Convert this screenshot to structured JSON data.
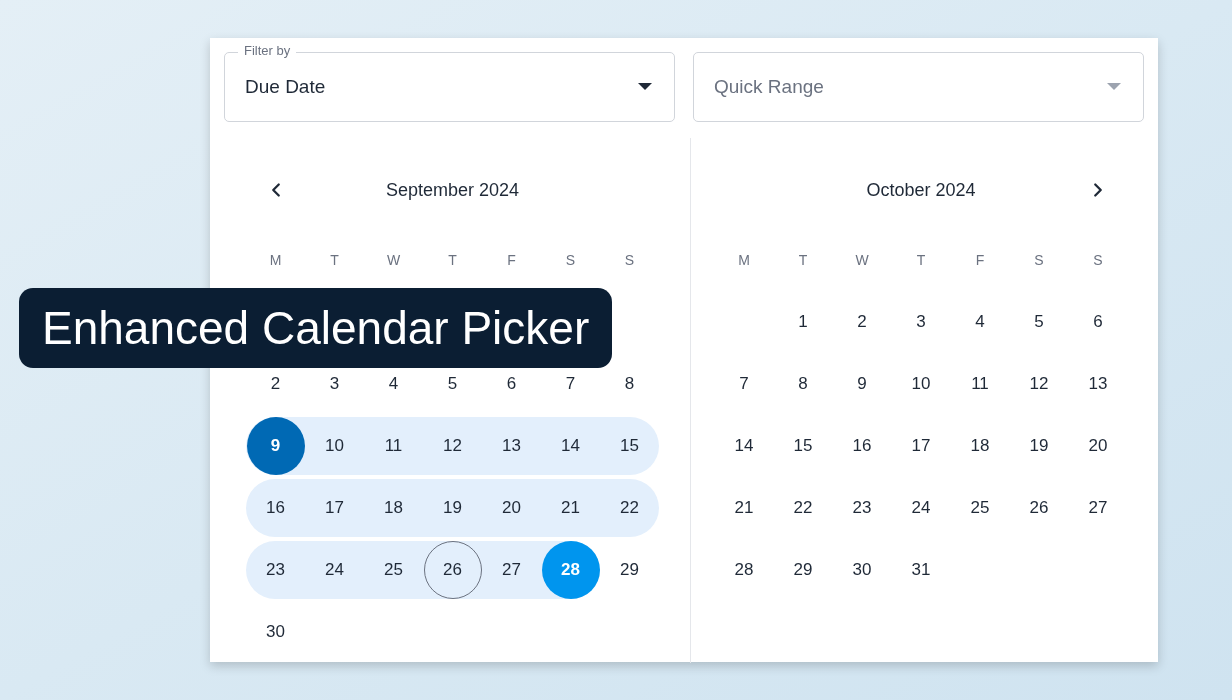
{
  "filters": [
    {
      "label": "Filter by",
      "value": "Due Date"
    },
    {
      "placeholder": "Quick Range"
    }
  ],
  "calendars": [
    {
      "title": "September 2024",
      "nav": {
        "kind": "prev"
      },
      "weekdays": [
        "M",
        "T",
        "W",
        "T",
        "F",
        "S",
        "S"
      ],
      "weeks": [
        {
          "kind": "covered"
        },
        {
          "kind": "start",
          "days": [
            {
              "label": "2",
              "in_range": false,
              "kind": "plain"
            },
            {
              "label": "3",
              "in_range": false,
              "kind": "plain"
            },
            {
              "label": "4",
              "in_range": false,
              "kind": "plain"
            },
            {
              "label": "5",
              "in_range": false,
              "kind": "plain"
            },
            {
              "label": "6",
              "in_range": false,
              "kind": "plain"
            },
            {
              "label": "7",
              "in_range": false,
              "kind": "plain"
            },
            {
              "label": "8",
              "in_range": false,
              "kind": "plain"
            }
          ]
        },
        {
          "kind": "start",
          "days": [
            {
              "label": "9",
              "in_range": true,
              "kind": "start"
            },
            {
              "label": "10",
              "in_range": true,
              "kind": "plain"
            },
            {
              "label": "11",
              "in_range": true,
              "kind": "plain"
            },
            {
              "label": "12",
              "in_range": true,
              "kind": "plain"
            },
            {
              "label": "13",
              "in_range": true,
              "kind": "plain"
            },
            {
              "label": "14",
              "in_range": true,
              "kind": "plain"
            },
            {
              "label": "15",
              "in_range": true,
              "kind": "plain"
            }
          ]
        },
        {
          "kind": "start",
          "days": [
            {
              "label": "16",
              "in_range": true,
              "kind": "plain"
            },
            {
              "label": "17",
              "in_range": true,
              "kind": "plain"
            },
            {
              "label": "18",
              "in_range": true,
              "kind": "plain"
            },
            {
              "label": "19",
              "in_range": true,
              "kind": "plain"
            },
            {
              "label": "20",
              "in_range": true,
              "kind": "plain"
            },
            {
              "label": "21",
              "in_range": true,
              "kind": "plain"
            },
            {
              "label": "22",
              "in_range": true,
              "kind": "plain"
            }
          ]
        },
        {
          "kind": "start",
          "days": [
            {
              "label": "23",
              "in_range": true,
              "kind": "plain"
            },
            {
              "label": "24",
              "in_range": true,
              "kind": "plain"
            },
            {
              "label": "25",
              "in_range": true,
              "kind": "plain"
            },
            {
              "label": "26",
              "in_range": true,
              "kind": "today"
            },
            {
              "label": "27",
              "in_range": true,
              "kind": "plain"
            },
            {
              "label": "28",
              "in_range": true,
              "kind": "end"
            },
            {
              "label": "29",
              "in_range": false,
              "kind": "plain"
            }
          ]
        },
        {
          "kind": "start",
          "days": [
            {
              "label": "30",
              "in_range": false,
              "kind": "plain"
            }
          ]
        }
      ]
    },
    {
      "title": "October 2024",
      "nav": {
        "kind": "next"
      },
      "weekdays": [
        "M",
        "T",
        "W",
        "T",
        "F",
        "S",
        "S"
      ],
      "weeks": [
        {
          "kind": "end",
          "days": [
            {
              "label": "1",
              "in_range": false,
              "kind": "plain"
            },
            {
              "label": "2",
              "in_range": false,
              "kind": "plain"
            },
            {
              "label": "3",
              "in_range": false,
              "kind": "plain"
            },
            {
              "label": "4",
              "in_range": false,
              "kind": "plain"
            },
            {
              "label": "5",
              "in_range": false,
              "kind": "plain"
            },
            {
              "label": "6",
              "in_range": false,
              "kind": "plain"
            }
          ]
        },
        {
          "kind": "start",
          "days": [
            {
              "label": "7",
              "in_range": false,
              "kind": "plain"
            },
            {
              "label": "8",
              "in_range": false,
              "kind": "plain"
            },
            {
              "label": "9",
              "in_range": false,
              "kind": "plain"
            },
            {
              "label": "10",
              "in_range": false,
              "kind": "plain"
            },
            {
              "label": "11",
              "in_range": false,
              "kind": "plain"
            },
            {
              "label": "12",
              "in_range": false,
              "kind": "plain"
            },
            {
              "label": "13",
              "in_range": false,
              "kind": "plain"
            }
          ]
        },
        {
          "kind": "start",
          "days": [
            {
              "label": "14",
              "in_range": false,
              "kind": "plain"
            },
            {
              "label": "15",
              "in_range": false,
              "kind": "plain"
            },
            {
              "label": "16",
              "in_range": false,
              "kind": "plain"
            },
            {
              "label": "17",
              "in_range": false,
              "kind": "plain"
            },
            {
              "label": "18",
              "in_range": false,
              "kind": "plain"
            },
            {
              "label": "19",
              "in_range": false,
              "kind": "plain"
            },
            {
              "label": "20",
              "in_range": false,
              "kind": "plain"
            }
          ]
        },
        {
          "kind": "start",
          "days": [
            {
              "label": "21",
              "in_range": false,
              "kind": "plain"
            },
            {
              "label": "22",
              "in_range": false,
              "kind": "plain"
            },
            {
              "label": "23",
              "in_range": false,
              "kind": "plain"
            },
            {
              "label": "24",
              "in_range": false,
              "kind": "plain"
            },
            {
              "label": "25",
              "in_range": false,
              "kind": "plain"
            },
            {
              "label": "26",
              "in_range": false,
              "kind": "plain"
            },
            {
              "label": "27",
              "in_range": false,
              "kind": "plain"
            }
          ]
        },
        {
          "kind": "start",
          "days": [
            {
              "label": "28",
              "in_range": false,
              "kind": "plain"
            },
            {
              "label": "29",
              "in_range": false,
              "kind": "plain"
            },
            {
              "label": "30",
              "in_range": false,
              "kind": "plain"
            },
            {
              "label": "31",
              "in_range": false,
              "kind": "plain"
            }
          ]
        }
      ]
    }
  ],
  "banner": {
    "text": "Enhanced Calendar Picker"
  }
}
